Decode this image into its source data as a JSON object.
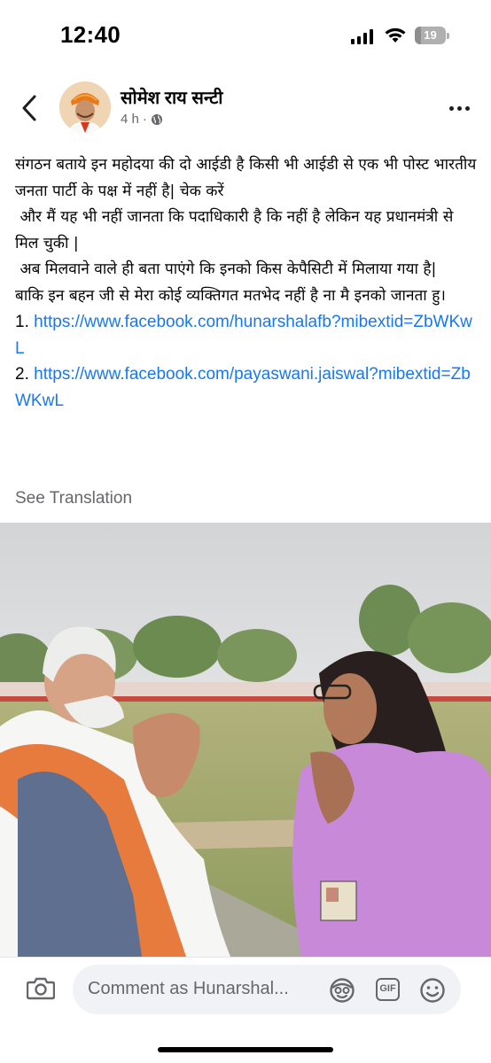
{
  "status_bar": {
    "time": "12:40",
    "battery": "19",
    "battery_level_percent": 19,
    "icons": [
      "signal-icon",
      "wifi-icon",
      "battery-icon"
    ]
  },
  "header": {
    "author_name": "सोमेश राय सन्टी",
    "time_ago": "4 h",
    "separator": "·",
    "icons": [
      "back-arrow-icon",
      "globe-icon",
      "more-options-icon"
    ]
  },
  "post": {
    "lines": [
      "संगठन बताये इन महोदया की दो आईडी है किसी भी आईडी से एक भी पोस्ट भारतीय जनता पार्टी के पक्ष में नहीं है| चेक करें",
      " और मैं यह भी नहीं जानता कि पदाधिकारी है कि नहीं है लेकिन यह प्रधानमंत्री से मिल चुकी |",
      " अब मिलवाने वाले ही बता पाएंगे कि इनको किस केपैसिटी में मिलाया गया है|",
      "बाकि इन बहन जी से मेरा कोई व्यक्तिगत मतभेद नहीं है ना मै इनको जानता हु।"
    ],
    "links": [
      {
        "prefix": "1. ",
        "url": "https://www.facebook.com/hunarshalafb?mibextid=ZbWKwL"
      },
      {
        "prefix": "2. ",
        "url": "https://www.facebook.com/payaswani.jaiswal?mibextid=ZbWKwL"
      }
    ],
    "see_translation": "See Translation"
  },
  "comment_bar": {
    "placeholder": "Comment as Hunarshal...",
    "gif_label": "GIF",
    "icons": [
      "camera-icon",
      "avatar-sticker-icon",
      "gif-icon",
      "emoji-icon"
    ]
  },
  "colors": {
    "link": "#1877f2",
    "secondary_text": "#65676b",
    "input_background": "#f0f2f5"
  }
}
